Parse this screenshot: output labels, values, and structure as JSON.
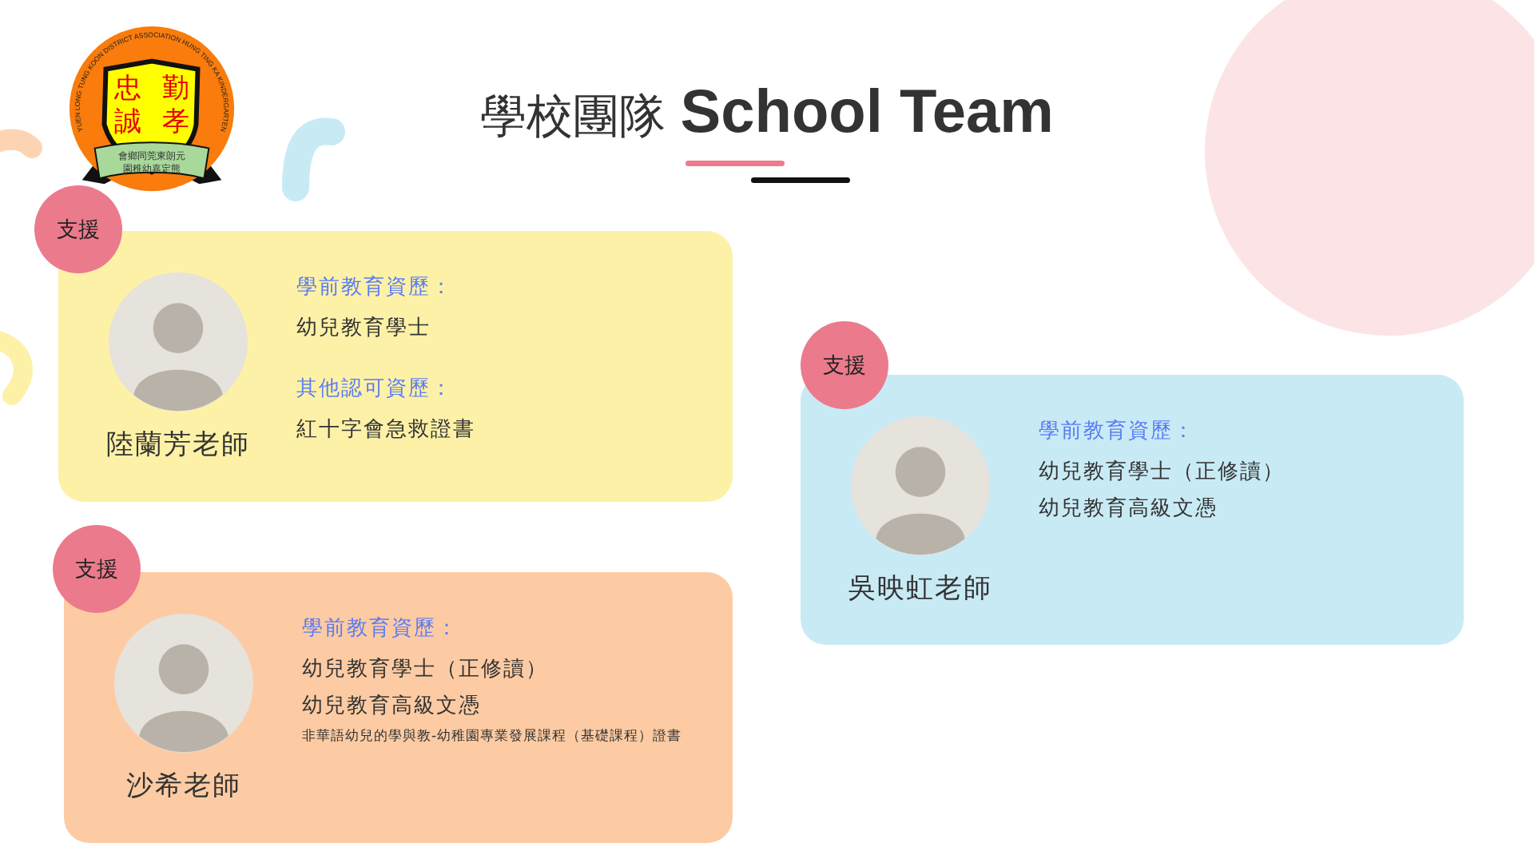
{
  "logo": {
    "ring_text": "YUEN LONG TUNG KOON DISTRICT ASSOCIATION HUNG TING KA KINDERGARTEN",
    "motto": [
      "忠",
      "勤",
      "誠",
      "孝"
    ],
    "ribbon": [
      "會鄉同莞東朗元",
      "園稚幼嘉定熊"
    ]
  },
  "heading": {
    "chinese": "學校團隊",
    "english": "School Team"
  },
  "staff": [
    {
      "badge": "支援",
      "name": "陸蘭芳老師",
      "color": "#fdf1a7",
      "sections": [
        {
          "heading": "學前教育資歷：",
          "lines": [
            {
              "text": "幼兒教育學士",
              "kind": "main"
            }
          ]
        },
        {
          "heading": "其他認可資歷：",
          "lines": [
            {
              "text": "紅十字會急救證書",
              "kind": "main"
            }
          ]
        }
      ]
    },
    {
      "badge": "支援",
      "name": "吳映虹老師",
      "color": "#c8eaf5",
      "sections": [
        {
          "heading": "學前教育資歷：",
          "lines": [
            {
              "text": "幼兒教育學士（正修讀）",
              "kind": "main"
            },
            {
              "text": "幼兒教育高級文憑",
              "kind": "main"
            }
          ]
        }
      ]
    },
    {
      "badge": "支援",
      "name": "沙希老師",
      "color": "#fdcba3",
      "sections": [
        {
          "heading": "學前教育資歷：",
          "lines": [
            {
              "text": "幼兒教育學士（正修讀）",
              "kind": "main"
            },
            {
              "text": "幼兒教育高級文憑",
              "kind": "main"
            },
            {
              "text": "非華語幼兒的學與教-幼稚園專業發展課程（基礎課程）證書",
              "kind": "note"
            }
          ]
        }
      ]
    }
  ]
}
